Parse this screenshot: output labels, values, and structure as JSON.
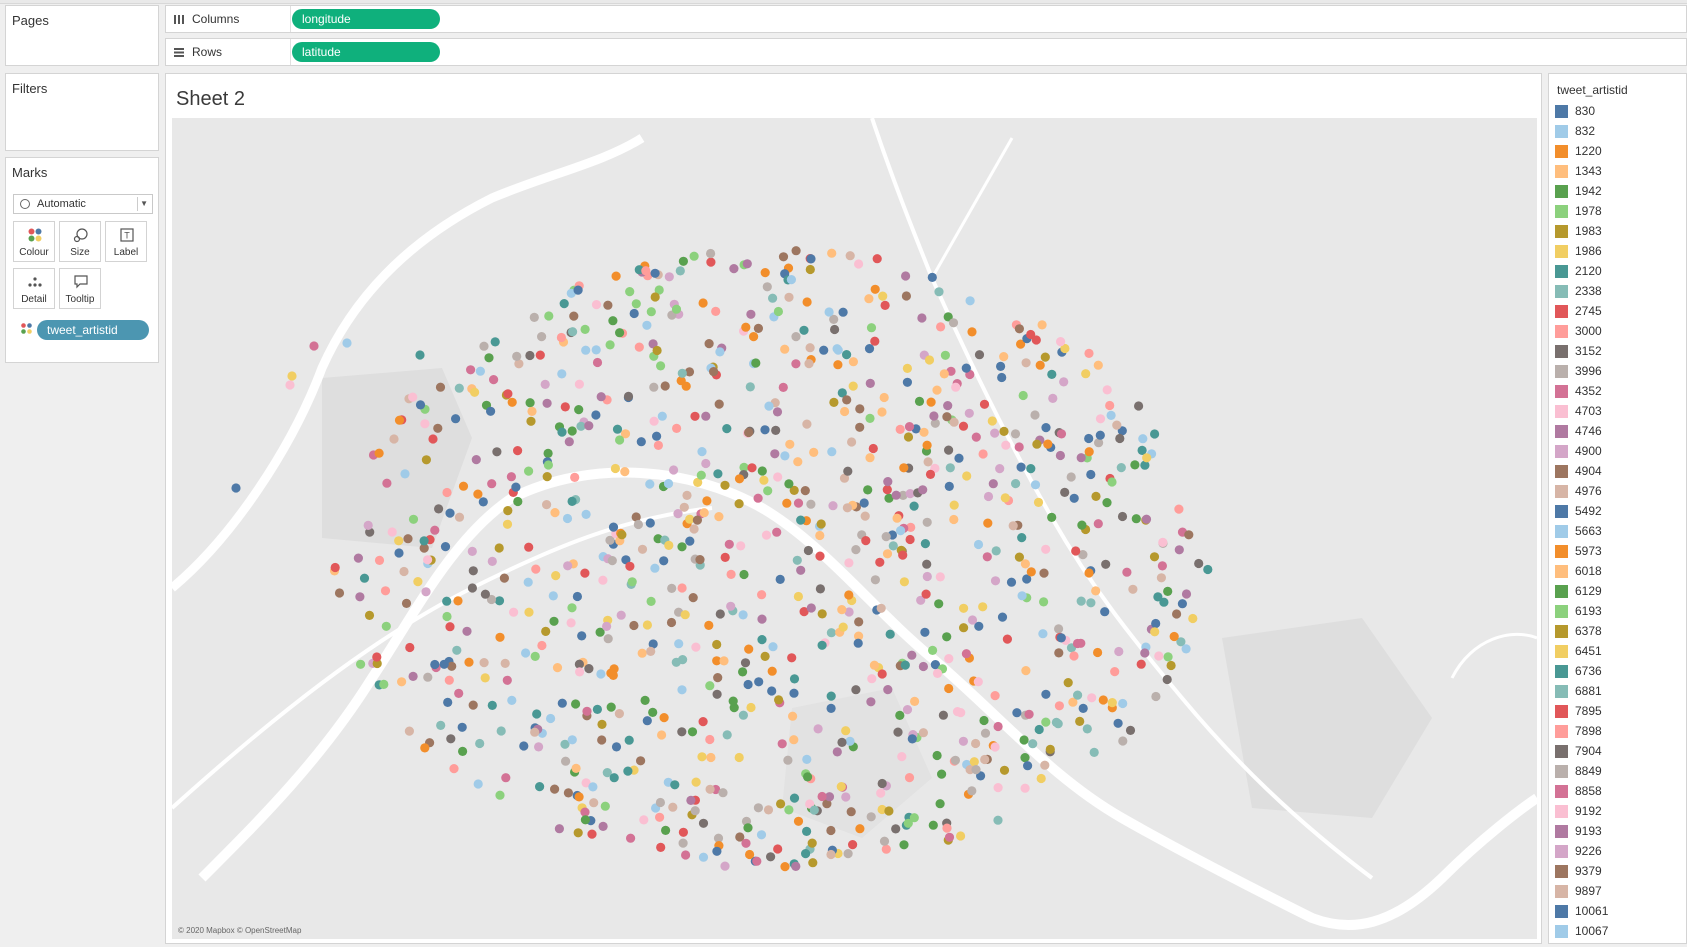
{
  "shelves": {
    "pages": {
      "title": "Pages"
    },
    "columns": {
      "label": "Columns",
      "pill": "longitude"
    },
    "rows": {
      "label": "Rows",
      "pill": "latitude"
    },
    "filters": {
      "title": "Filters"
    }
  },
  "marks": {
    "title": "Marks",
    "mark_type": "Automatic",
    "buttons": {
      "colour": "Colour",
      "size": "Size",
      "label": "Label",
      "detail": "Detail",
      "tooltip": "Tooltip"
    },
    "field_pill": "tweet_artistid"
  },
  "sheet": {
    "title": "Sheet 2",
    "map_credit": "© 2020 Mapbox © OpenStreetMap"
  },
  "legend": {
    "title": "tweet_artistid",
    "items": [
      {
        "label": "830",
        "color": "#4e79a7"
      },
      {
        "label": "832",
        "color": "#a0cbe8"
      },
      {
        "label": "1220",
        "color": "#f28e2b"
      },
      {
        "label": "1343",
        "color": "#ffbe7d"
      },
      {
        "label": "1942",
        "color": "#59a14f"
      },
      {
        "label": "1978",
        "color": "#8cd17d"
      },
      {
        "label": "1983",
        "color": "#b6992d"
      },
      {
        "label": "1986",
        "color": "#f1ce63"
      },
      {
        "label": "2120",
        "color": "#499894"
      },
      {
        "label": "2338",
        "color": "#86bcb6"
      },
      {
        "label": "2745",
        "color": "#e15759"
      },
      {
        "label": "3000",
        "color": "#ff9d9a"
      },
      {
        "label": "3152",
        "color": "#79706e"
      },
      {
        "label": "3996",
        "color": "#bab0ac"
      },
      {
        "label": "4352",
        "color": "#d37295"
      },
      {
        "label": "4703",
        "color": "#fabfd2"
      },
      {
        "label": "4746",
        "color": "#b07aa1"
      },
      {
        "label": "4900",
        "color": "#d4a6c8"
      },
      {
        "label": "4904",
        "color": "#9d7660"
      },
      {
        "label": "4976",
        "color": "#d7b5a6"
      },
      {
        "label": "5492",
        "color": "#4e79a7"
      },
      {
        "label": "5663",
        "color": "#a0cbe8"
      },
      {
        "label": "5973",
        "color": "#f28e2b"
      },
      {
        "label": "6018",
        "color": "#ffbe7d"
      },
      {
        "label": "6129",
        "color": "#59a14f"
      },
      {
        "label": "6193",
        "color": "#8cd17d"
      },
      {
        "label": "6378",
        "color": "#b6992d"
      },
      {
        "label": "6451",
        "color": "#f1ce63"
      },
      {
        "label": "6736",
        "color": "#499894"
      },
      {
        "label": "6881",
        "color": "#86bcb6"
      },
      {
        "label": "7895",
        "color": "#e15759"
      },
      {
        "label": "7898",
        "color": "#ff9d9a"
      },
      {
        "label": "7904",
        "color": "#79706e"
      },
      {
        "label": "8849",
        "color": "#bab0ac"
      },
      {
        "label": "8858",
        "color": "#d37295"
      },
      {
        "label": "9192",
        "color": "#fabfd2"
      },
      {
        "label": "9193",
        "color": "#b07aa1"
      },
      {
        "label": "9226",
        "color": "#d4a6c8"
      },
      {
        "label": "9379",
        "color": "#9d7660"
      },
      {
        "label": "9897",
        "color": "#d7b5a6"
      },
      {
        "label": "10061",
        "color": "#4e79a7"
      },
      {
        "label": "10067",
        "color": "#a0cbe8"
      }
    ]
  }
}
